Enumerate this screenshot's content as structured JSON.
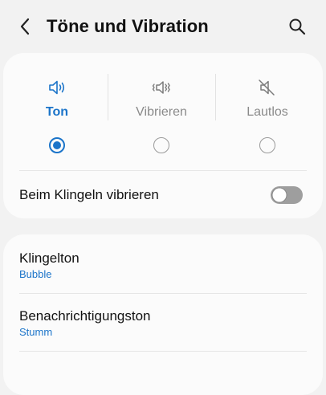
{
  "header": {
    "title": "Töne und Vibration",
    "back_icon": "chevron-left-icon",
    "search_icon": "search-icon"
  },
  "sound_mode": {
    "options": [
      {
        "label": "Ton",
        "icon": "speaker-sound-icon",
        "selected": true
      },
      {
        "label": "Vibrieren",
        "icon": "vibrate-icon",
        "selected": false
      },
      {
        "label": "Lautlos",
        "icon": "speaker-mute-icon",
        "selected": false
      }
    ],
    "vibrate_while_ringing": {
      "label": "Beim Klingeln vibrieren",
      "enabled": false
    }
  },
  "settings": {
    "items": [
      {
        "title": "Klingelton",
        "value": "Bubble"
      },
      {
        "title": "Benachrichtigungston",
        "value": "Stumm"
      }
    ]
  },
  "colors": {
    "accent": "#1b74c9",
    "background": "#f2f2f2",
    "card": "#fbfbfb",
    "inactive_text": "#8a8a8a",
    "toggle_off": "#9e9e9e"
  }
}
